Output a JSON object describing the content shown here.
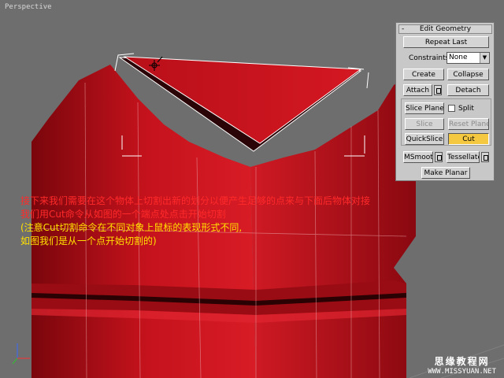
{
  "viewport": {
    "label": "Perspective"
  },
  "panel": {
    "title": "Edit Geometry",
    "collapse_symbol": "-",
    "repeat_last": "Repeat Last",
    "constraints_label": "Constraints:",
    "constraints_value": "None",
    "create": "Create",
    "collapse": "Collapse",
    "attach": "Attach",
    "detach": "Detach",
    "slice_plane": "Slice Plane",
    "split": "Split",
    "slice": "Slice",
    "reset_plane": "Reset Plane",
    "quickslice": "QuickSlice",
    "cut": "Cut",
    "msmooth": "MSmooth",
    "tessellate": "Tessellate",
    "make_planar": "Make Planar"
  },
  "tutorial_text": {
    "line1": "接下来我们需要在这个物体上切割出新的划分以便产生足够的点来与下面后物体对接",
    "line2": "我们用Cut命令从如图的一个端点处点击开始切割",
    "line3": "(注意Cut切割命令在不同对象上鼠标的表现形式不同,",
    "line4": "如图我们是从一个点开始切割的)"
  },
  "watermark": {
    "cn": "思缘教程网",
    "url": "WWW.MISSYUAN.NET"
  },
  "colors": {
    "mesh_red": "#c4121c",
    "active_yellow": "#f5c842"
  }
}
